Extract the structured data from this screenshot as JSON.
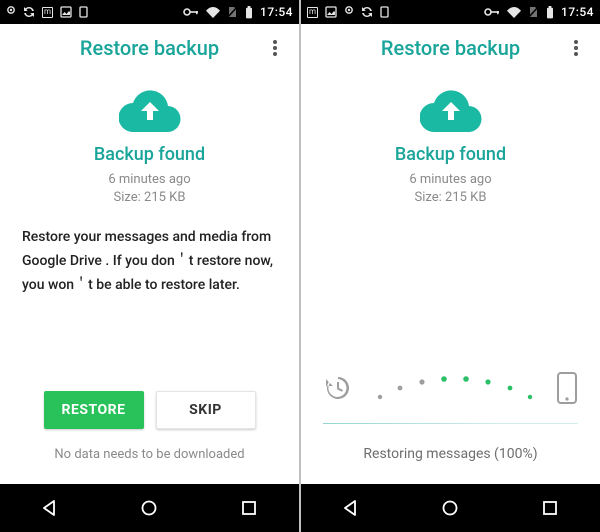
{
  "accent": "#1aa59a",
  "status": {
    "time": "17:54"
  },
  "appbar": {
    "title": "Restore backup"
  },
  "backup": {
    "heading": "Backup found",
    "time": "6 minutes ago",
    "size": "Size: 215 KB"
  },
  "left": {
    "description": "Restore your messages and media from Google Drive . If you don＇t restore now, you won＇t be able to restore later.",
    "restore_label": "RESTORE",
    "skip_label": "SKIP",
    "sub": "No data needs to be downloaded"
  },
  "right": {
    "progress_text": "Restoring messages (100%)"
  }
}
